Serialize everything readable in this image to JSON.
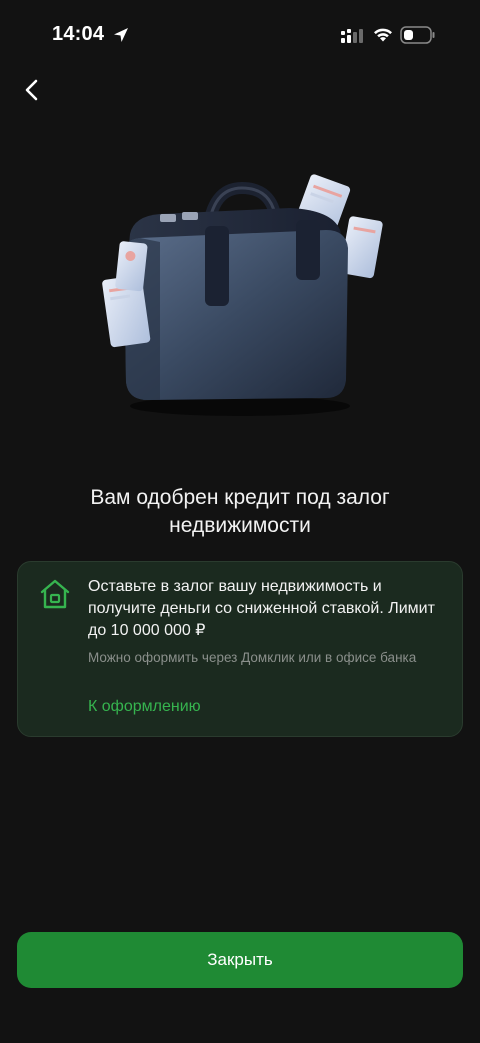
{
  "status_bar": {
    "time": "14:04"
  },
  "icons": {
    "back": "chevron-left-icon",
    "location": "location-arrow-icon",
    "signal": "cellular-signal-icon",
    "wifi": "wifi-icon",
    "battery": "battery-icon",
    "house": "house-icon"
  },
  "colors": {
    "background": "#121212",
    "card_background": "#1b2a1f",
    "accent_green": "#36b44f",
    "button_green": "#1f8a34"
  },
  "main": {
    "title": "Вам одобрен кредит под залог недвижимости",
    "offer": {
      "text": "Оставьте в залог вашу недвижимость и получите деньги со сниженной ставкой. Лимит до 10 000 000 ₽",
      "note": "Можно оформить через Домклик или в офисе банка",
      "link": "К оформлению"
    },
    "close_button": "Закрыть"
  }
}
